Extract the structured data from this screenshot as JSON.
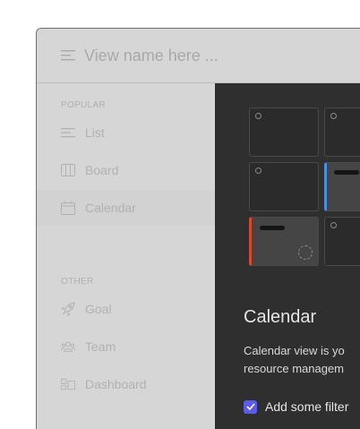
{
  "header": {
    "title": "View name here ..."
  },
  "sidebar": {
    "popular_label": "POPULAR",
    "other_label": "OTHER",
    "popular": [
      {
        "label": "List",
        "icon": "list-icon"
      },
      {
        "label": "Board",
        "icon": "board-icon"
      },
      {
        "label": "Calendar",
        "icon": "calendar-icon",
        "active": true
      }
    ],
    "other": [
      {
        "label": "Goal",
        "icon": "rocket-icon"
      },
      {
        "label": "Team",
        "icon": "team-icon"
      },
      {
        "label": "Dashboard",
        "icon": "dashboard-icon"
      }
    ]
  },
  "panel": {
    "title": "Calendar",
    "description_line1": "Calendar view is yo",
    "description_line2": "resource managem",
    "checkbox_label": "Add some filter",
    "checkbox_checked": true
  },
  "colors": {
    "accent": "#5b5ce8",
    "blue_event": "#4a8fe0",
    "red_event": "#d84a2c"
  }
}
